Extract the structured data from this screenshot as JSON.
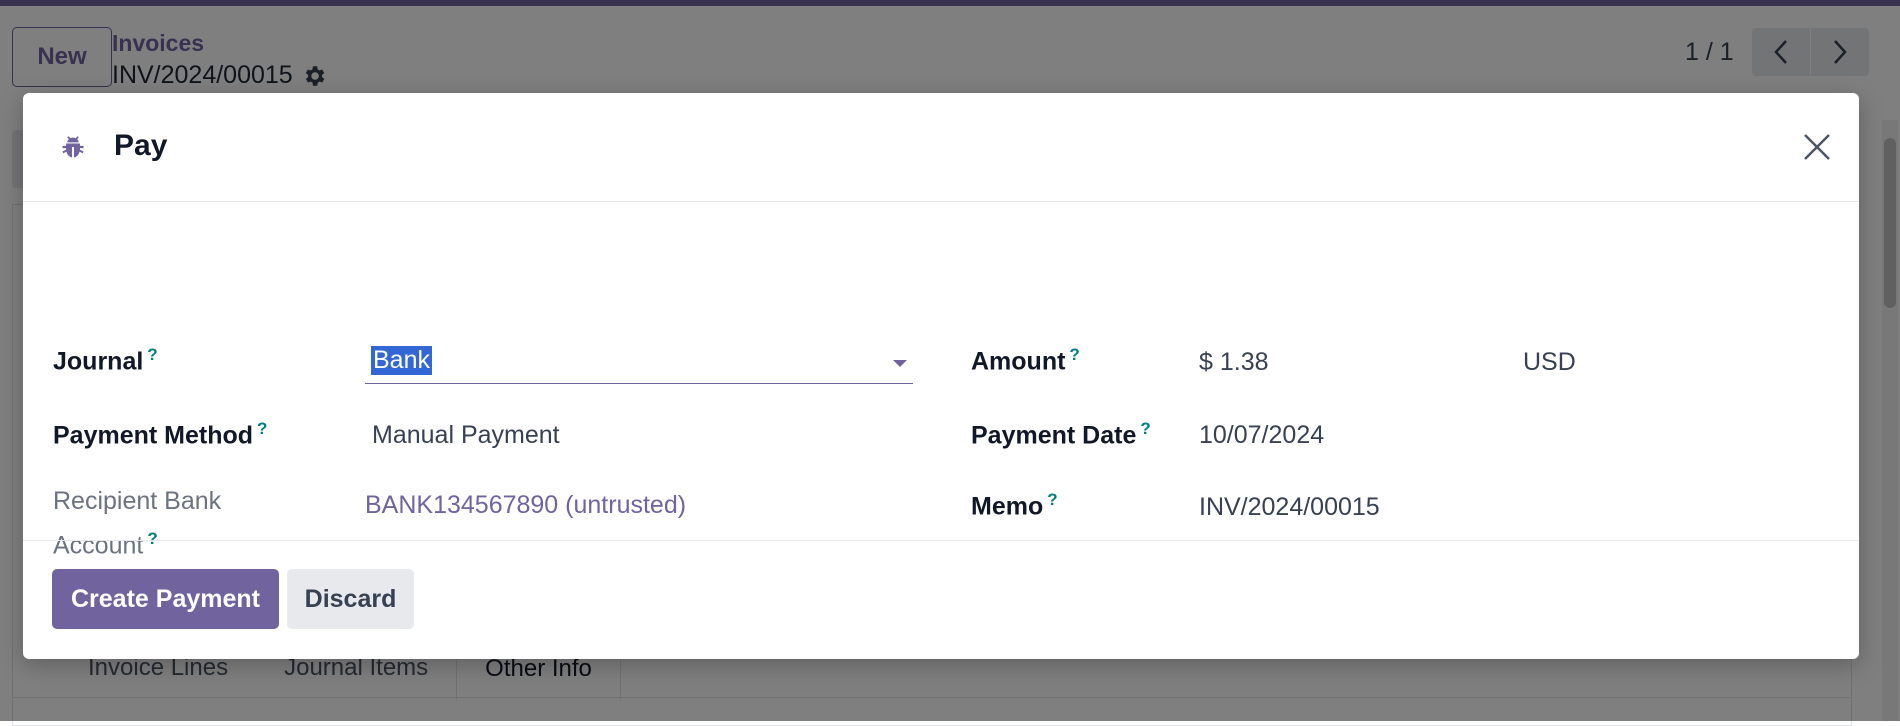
{
  "control_panel": {
    "new_label": "New",
    "breadcrumb_parent": "Invoices",
    "record_name": "INV/2024/00015",
    "pager_value": "1 / 1"
  },
  "notebook": {
    "tabs": [
      {
        "label": "Invoice Lines"
      },
      {
        "label": "Journal Items"
      },
      {
        "label": "Other Info"
      }
    ]
  },
  "dialog": {
    "title": "Pay",
    "fields": {
      "journal": {
        "label": "Journal",
        "help": "?",
        "value": "Bank"
      },
      "payment_method": {
        "label": "Payment Method",
        "help": "?",
        "value": "Manual Payment"
      },
      "recipient_bank": {
        "label_line1": "Recipient Bank",
        "label_line2": "Account",
        "help": "?",
        "value": "BANK134567890 (untrusted)"
      },
      "amount": {
        "label": "Amount",
        "help": "?",
        "value": "$ 1.38",
        "currency": "USD"
      },
      "payment_date": {
        "label": "Payment Date",
        "help": "?",
        "value": "10/07/2024"
      },
      "memo": {
        "label": "Memo",
        "help": "?",
        "value": "INV/2024/00015"
      }
    },
    "buttons": {
      "create_payment": "Create Payment",
      "discard": "Discard"
    }
  },
  "colors": {
    "brand": "#71639e",
    "help": "#017e84",
    "selection": "#3367d6"
  },
  "icons": {
    "header": "bug-icon",
    "close": "close-icon",
    "settings": "gear-icon"
  }
}
